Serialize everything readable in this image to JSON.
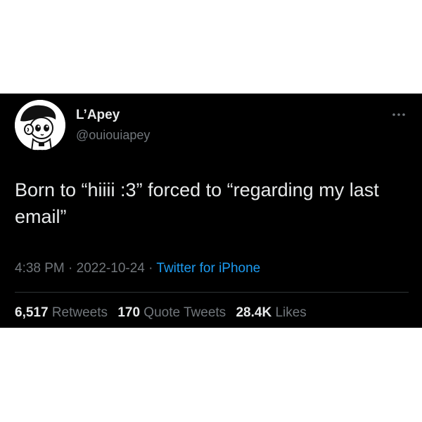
{
  "tweet": {
    "display_name": "L’Apey",
    "handle": "@ouiouiapey",
    "more_icon": "ellipsis-icon",
    "text": "Born to “hiiii :3” forced to “regarding my last email”",
    "time": "4:38 PM",
    "separator": " · ",
    "date": "2022-10-24",
    "source": "Twitter for iPhone",
    "stats": {
      "retweets_count": "6,517",
      "retweets_label": "Retweets",
      "quote_tweets_count": "170",
      "quote_tweets_label": "Quote Tweets",
      "likes_count": "28.4K",
      "likes_label": "Likes"
    }
  },
  "colors": {
    "card_background": "#000000",
    "primary_text": "#e7e9ea",
    "secondary_text": "#71767b",
    "link": "#1d9bf0",
    "divider": "#2f3336"
  }
}
